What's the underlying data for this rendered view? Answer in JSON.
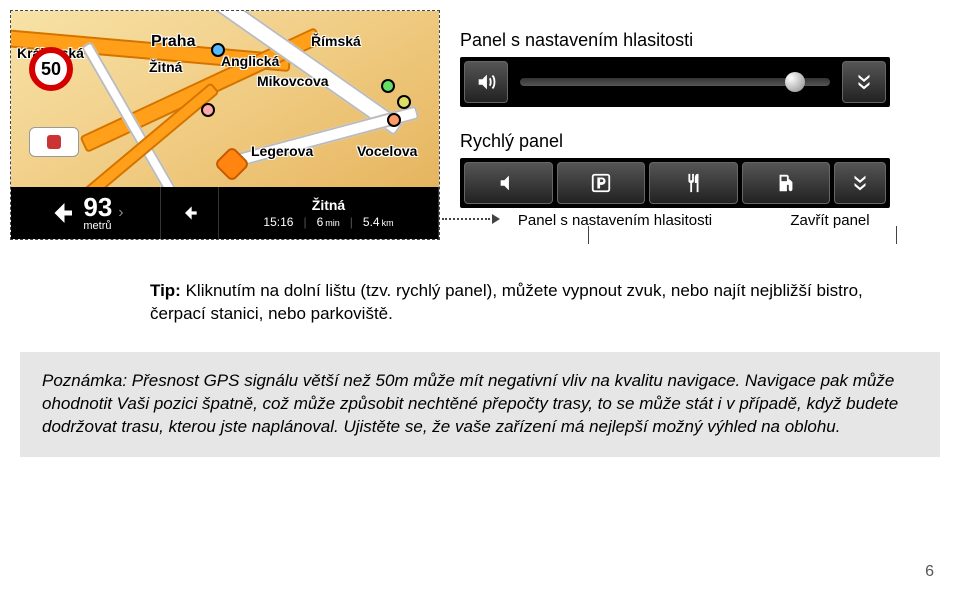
{
  "map": {
    "speedLimit": "50",
    "streets": {
      "praha": "Praha",
      "rimska": "Římská",
      "kralovska": "Královská",
      "zitna": "Žitná",
      "anglicka": "Anglická",
      "mikovcova": "Mikovcova",
      "legerova": "Legerova",
      "vocelova": "Vocelova"
    }
  },
  "navBar": {
    "mainDistance": "93",
    "mainDistanceUnit": "metrů",
    "routeName": "Žitná",
    "eta": "15:16",
    "remainingTimeValue": "6",
    "remainingTimeUnit": "min",
    "remainingDistValue": "5.4",
    "remainingDistUnit": "km"
  },
  "rightPanels": {
    "volumeTitle": "Panel s nastavením hlasitosti",
    "quickTitle": "Rychlý panel",
    "calloutLeft": "Panel s nastavením hlasitosti",
    "calloutRight": "Zavřít panel"
  },
  "tip": {
    "label": "Tip:",
    "text": " Kliknutím na dolní lištu (tzv. rychlý panel), můžete vypnout zvuk, nebo najít nejbližší bistro, čerpací stanici, nebo parkoviště."
  },
  "note": "Poznámka: Přesnost GPS signálu větší než 50m může mít negativní vliv na kvalitu navigace. Navigace pak může ohodnotit Vaši pozici špatně, což může způsobit nechtěné přepočty trasy, to se může stát i v případě, když budete dodržovat trasu, kterou jste naplánoval. Ujistěte se, že vaše zařízení má nejlepší možný výhled na oblohu.",
  "pageNumber": "6",
  "icons": {
    "speaker": "speaker-icon",
    "collapse": "collapse-icon",
    "mute": "mute-icon",
    "parking": "parking-icon",
    "restaurant": "restaurant-icon",
    "fuel": "fuel-icon",
    "turnLeft": "turn-left-icon"
  },
  "colors": {
    "barBg": "#000000",
    "buttonGradTop": "#555555",
    "buttonGradBot": "#222222",
    "roadOrange": "#ff9f1a",
    "speedRing": "#d40000"
  }
}
